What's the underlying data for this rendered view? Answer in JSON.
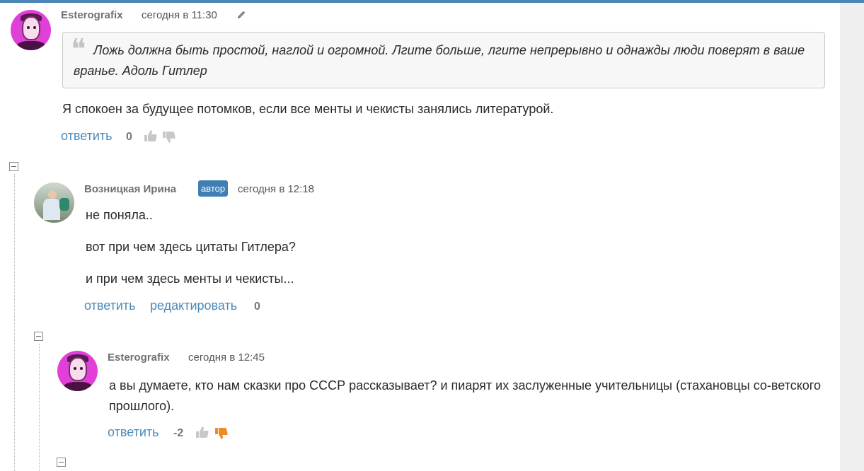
{
  "comments": [
    {
      "author": "Esterografix",
      "date": "сегодня в 11:30",
      "quote": "Ложь должна быть простой, наглой и огромной. Лгите больше, лгите непрерывно и однажды люди поверят в ваше вранье. Адоль Гитлер",
      "text": "Я спокоен за будущее потомков, если все менты и чекисты занялись литературой.",
      "reply_label": "ответить",
      "score": "0"
    },
    {
      "author": "Возницкая Ирина",
      "badge": "автор",
      "date": "сегодня в 12:18",
      "paragraphs": [
        "не поняла..",
        "вот при чем здесь цитаты Гитлера?",
        "и при чем здесь менты и чекисты..."
      ],
      "reply_label": "ответить",
      "edit_label": "редактировать",
      "score": "0"
    },
    {
      "author": "Esterografix",
      "date": "сегодня в 12:45",
      "text": "а вы думаете, кто нам сказки про СССР рассказывает? и пиарят их заслуженные учительницы (стахановцы со-ветского прошлого).",
      "reply_label": "ответить",
      "score": "-2"
    }
  ],
  "icons": {
    "edit": "pencil-icon",
    "like": "thumbs-up-icon",
    "dislike": "thumbs-down-icon",
    "collapse": "collapse-minus-icon"
  },
  "colors": {
    "accent_bar": "#4a87b5",
    "link": "#4a8ab8",
    "badge": "#3f7fb5",
    "dislike_active": "#f08a24",
    "thumb_inactive": "#c8c8c8"
  }
}
